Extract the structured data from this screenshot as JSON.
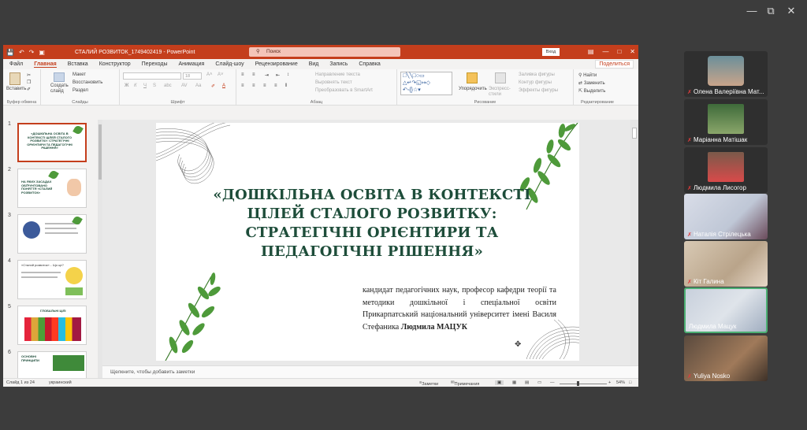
{
  "window_controls": {
    "minimize": "—",
    "restore": "⧉",
    "close": "✕"
  },
  "ppt": {
    "title_bar": {
      "doc_title": "СТАЛИЙ РОЗВИТОК_1749402419  -  PowerPoint",
      "search_placeholder": "Поиск",
      "login": "Вход",
      "qat_icons": [
        "save-icon",
        "undo-icon",
        "redo-icon",
        "present-icon"
      ]
    },
    "menu_tabs": [
      "Файл",
      "Главная",
      "Вставка",
      "Конструктор",
      "Переходы",
      "Анимация",
      "Слайд-шоу",
      "Рецензирование",
      "Вид",
      "Запись",
      "Справка"
    ],
    "active_tab": "Главная",
    "share_label": "Поделиться",
    "ribbon": {
      "clipboard": {
        "paste": "Вставить",
        "group": "Буфер обмена"
      },
      "slides": {
        "create": "Создать слайд",
        "layout": "Макет",
        "reset": "Восстановить",
        "section": "Раздел",
        "group": "Слайды"
      },
      "font": {
        "group": "Шрифт",
        "size": "18"
      },
      "paragraph": {
        "direction": "Направление текста",
        "align": "Выровнять текст",
        "smartart": "Преобразовать в SmartArt",
        "group": "Абзац"
      },
      "drawing": {
        "arrange": "Упорядочить",
        "quick_styles": "Экспресс-стили",
        "fill": "Заливка фигуры",
        "outline": "Контур фигуры",
        "effects": "Эффекты фигуры",
        "group": "Рисование"
      },
      "editing": {
        "find": "Найти",
        "replace": "Заменить",
        "select": "Выделить",
        "group": "Редактирование"
      }
    },
    "thumbnails": [
      {
        "num": "1",
        "text": "«ДОШКІЛЬНА ОСВІТА В КОНТЕКСТІ ЦІЛЕЙ СТАЛОГО РОЗВИТКУ: СТРАТЕГІЧНІ ОРІЄНТИРИ ТА ПЕДАГОГІЧНІ РІШЕННЯ»"
      },
      {
        "num": "2",
        "text": "НА ЯКИХ ЗАСАДАХ ОБҐРУНТОВАНО ПОНЯТТЯ «СТАЛИЙ РОЗВИТОК»"
      },
      {
        "num": "3",
        "text": ""
      },
      {
        "num": "4",
        "text": "«Сталий розвиток»... Що це?"
      },
      {
        "num": "5",
        "text": "ГЛОБАЛЬНІ ЦІЛІ"
      },
      {
        "num": "6",
        "text": "ОСНОВНІ ПРИНЦИПИ"
      }
    ],
    "slide": {
      "title": "«ДОШКІЛЬНА ОСВІТА В КОНТЕКСТІ ЦІЛЕЙ СТАЛОГО РОЗВИТКУ: СТРАТЕГІЧНІ ОРІЄНТИРИ ТА ПЕДАГОГІЧНІ РІШЕННЯ»",
      "author_text": "кандидат педагогічних наук, професор кафедри теорії та методики дошкільної і спеціальної освіти Прикарпатський національний університет імені Василя Стефаника ",
      "author_name": "Людмила МАЦУК",
      "colors": {
        "title": "#1e4d3a",
        "leaf": "#4e9a3a"
      }
    },
    "notes_placeholder": "Щелкните, чтобы добавить заметки",
    "status": {
      "slide_counter": "Слайд 1 из 24",
      "language": "украинский",
      "notes": "Заметки",
      "comments": "Примечания",
      "zoom": "54%"
    }
  },
  "participants": [
    {
      "name": "Олена Валеріївна Мат...",
      "muted": true
    },
    {
      "name": "Маріанна Матішак",
      "muted": true
    },
    {
      "name": "Людмила Лисогор",
      "muted": true
    },
    {
      "name": "Наталія Стрілецька",
      "muted": true
    },
    {
      "name": "Кіт Галина",
      "muted": true
    },
    {
      "name": "Людмила Мацук",
      "muted": false
    },
    {
      "name": "Yuliya Nosko",
      "muted": true
    }
  ],
  "accent": "#c43e1c"
}
